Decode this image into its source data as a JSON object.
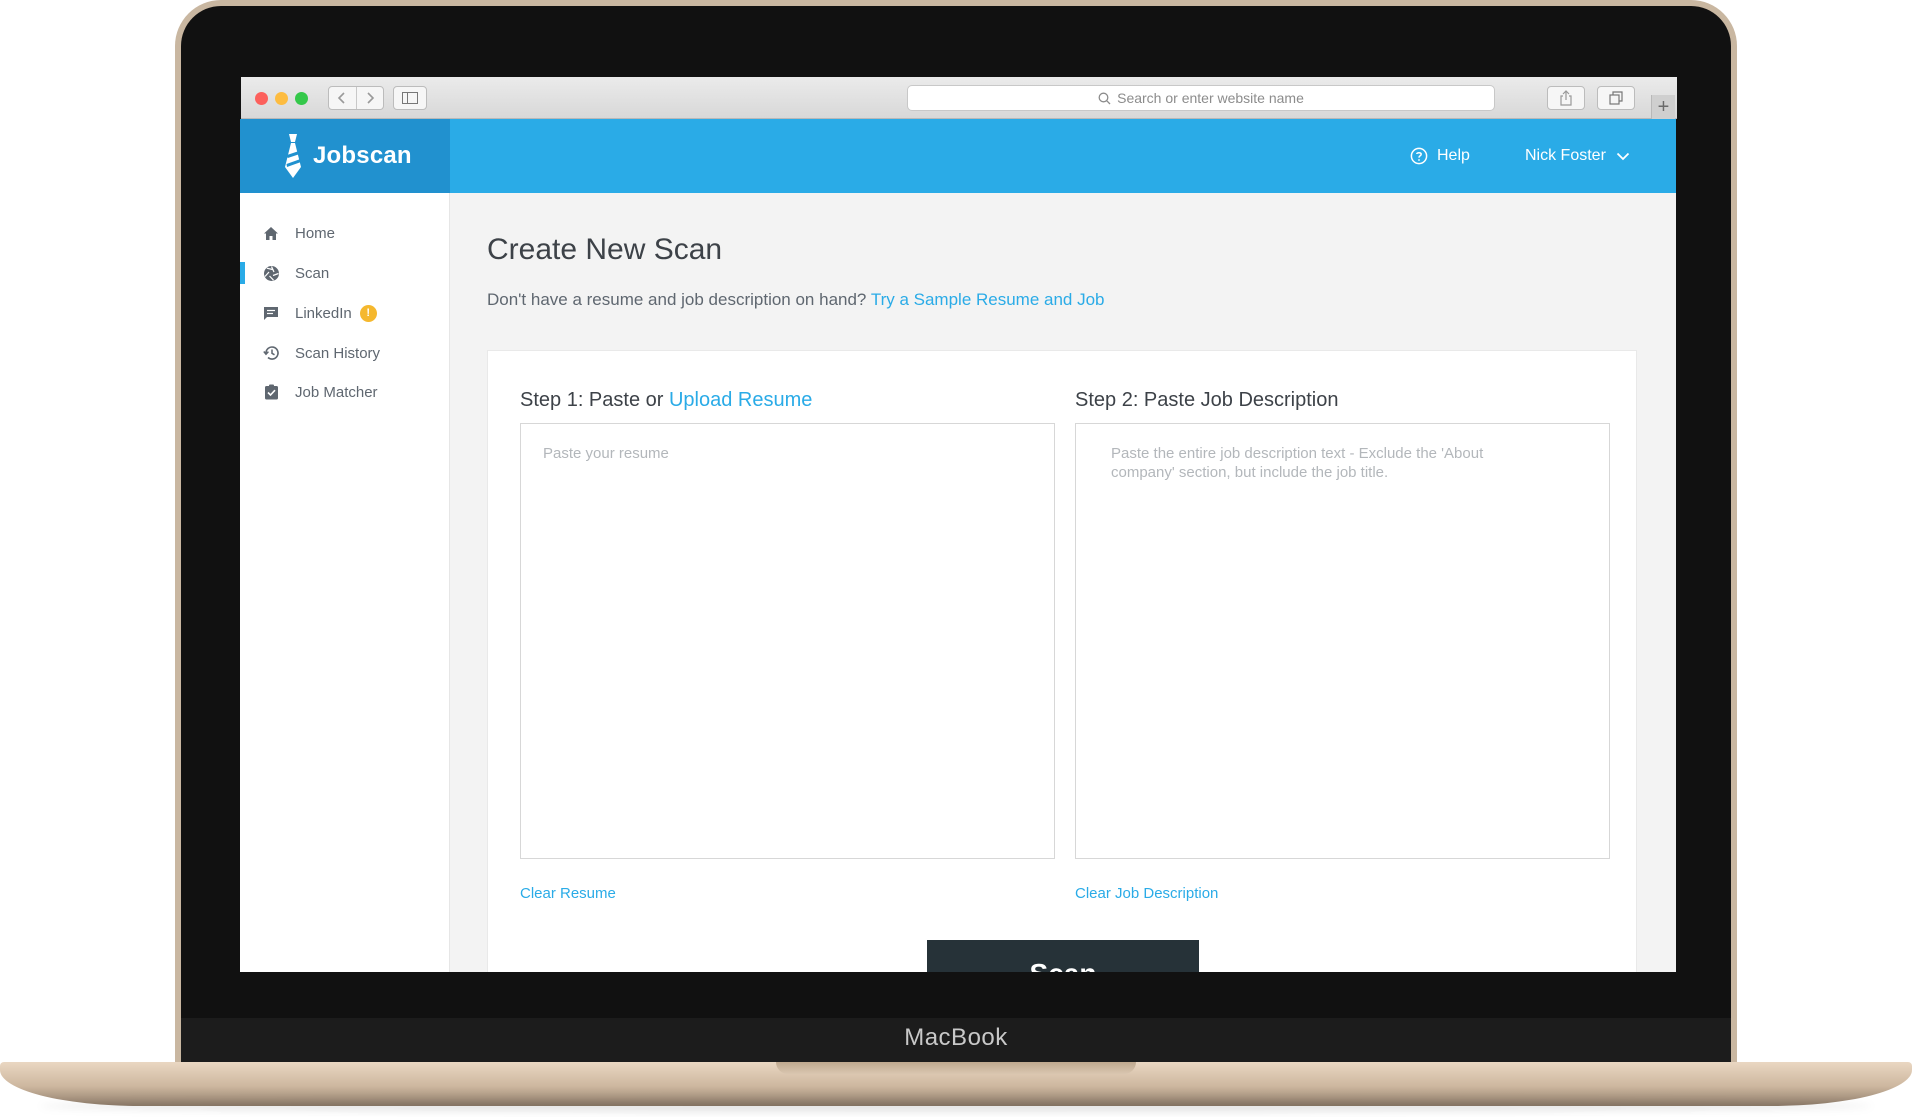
{
  "device": {
    "model_label": "MacBook"
  },
  "browser": {
    "address_placeholder": "Search or enter website name",
    "new_tab_label": "+"
  },
  "header": {
    "brand": "Jobscan",
    "help_label": "Help",
    "user_name": "Nick Foster",
    "colors": {
      "header_bg": "#2aabe7",
      "brand_bg": "#2191cf"
    }
  },
  "sidebar": {
    "items": [
      {
        "label": "Home",
        "icon": "home-icon",
        "active": false
      },
      {
        "label": "Scan",
        "icon": "scan-aperture-icon",
        "active": true
      },
      {
        "label": "LinkedIn",
        "icon": "chat-icon",
        "active": false,
        "badge": "!"
      },
      {
        "label": "Scan History",
        "icon": "history-icon",
        "active": false
      },
      {
        "label": "Job Matcher",
        "icon": "clipboard-check-icon",
        "active": false
      }
    ]
  },
  "main": {
    "title": "Create New Scan",
    "subtitle_text": "Don't have a resume and job description on hand?",
    "subtitle_link": "Try a Sample Resume and Job",
    "step1": {
      "heading_prefix": "Step 1: Paste or",
      "heading_link": "Upload Resume",
      "placeholder": "Paste your resume",
      "clear_label": "Clear Resume"
    },
    "step2": {
      "heading": "Step 2: Paste Job Description",
      "placeholder": "Paste the entire job description text - Exclude the 'About company' section, but include the job title.",
      "clear_label": "Clear Job Description"
    },
    "scan_button": "Scan",
    "colors": {
      "accent": "#2aabe7",
      "button_bg": "#263238"
    }
  }
}
